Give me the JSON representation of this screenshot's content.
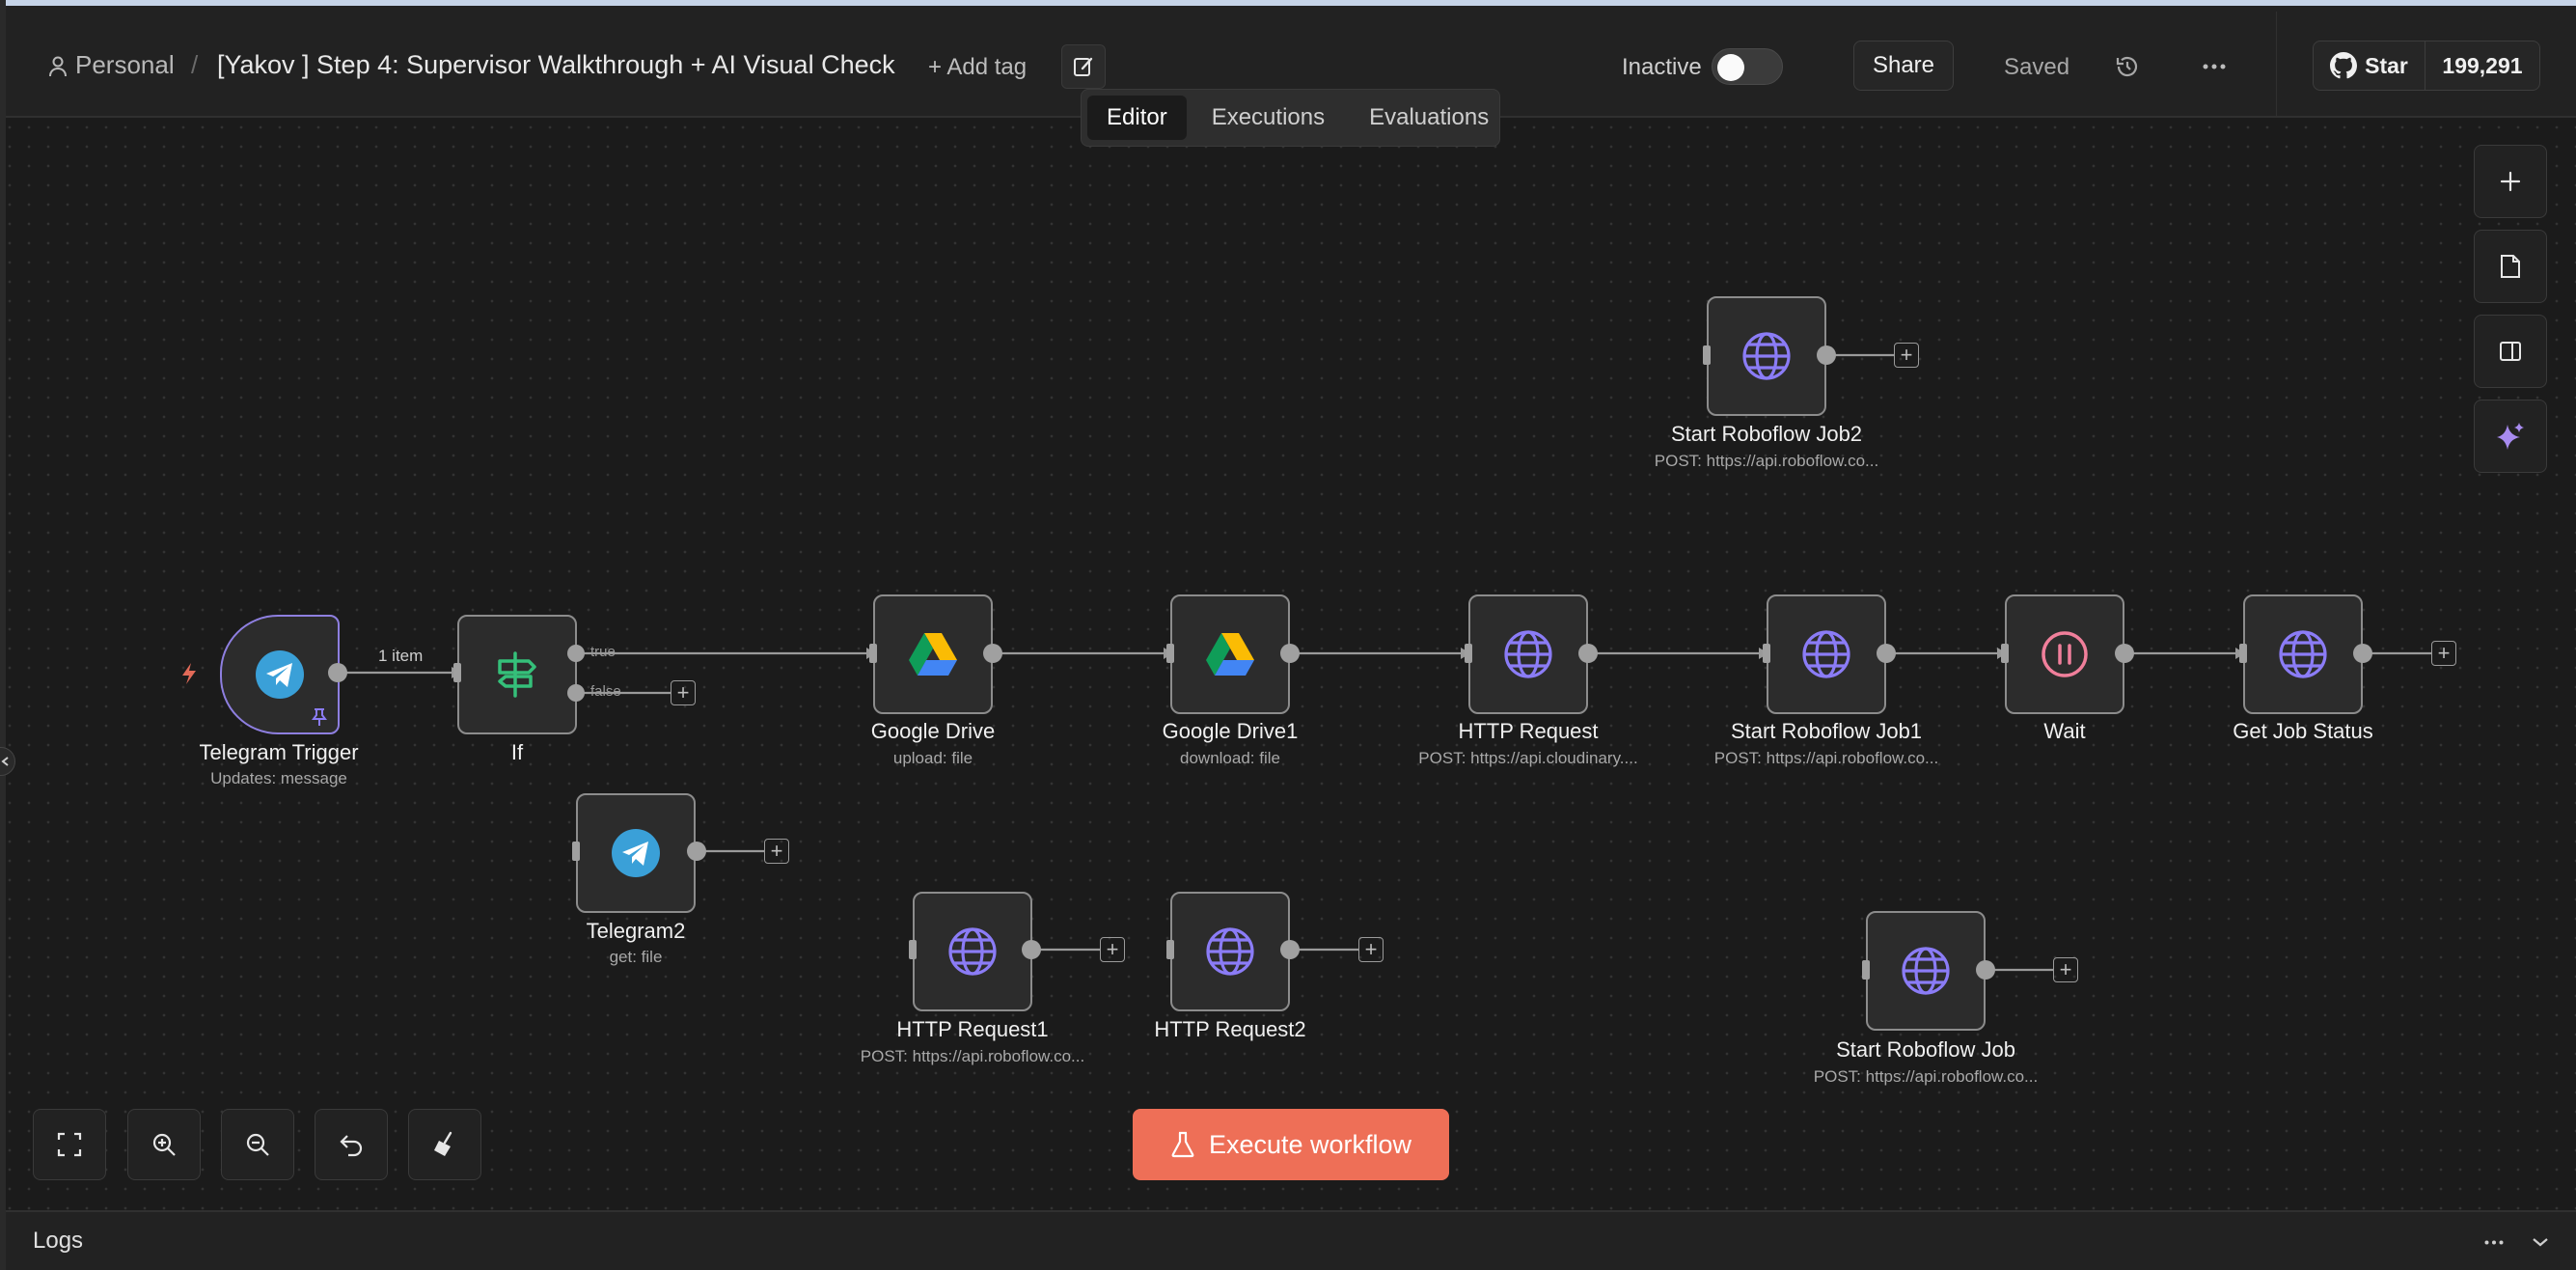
{
  "header": {
    "breadcrumb_project": "Personal",
    "separator": "/",
    "workflow_title": "[Yakov ] Step 4: Supervisor Walkthrough + AI Visual Check",
    "add_tag_label": "+ Add tag",
    "status_label": "Inactive",
    "active": false,
    "share_label": "Share",
    "saved_label": "Saved",
    "github_star_label": "Star",
    "github_star_count": "199,291"
  },
  "tabs": [
    {
      "label": "Editor",
      "active": true
    },
    {
      "label": "Executions",
      "active": false
    },
    {
      "label": "Evaluations",
      "active": false
    }
  ],
  "nodes": {
    "telegram_trigger": {
      "label": "Telegram Trigger",
      "sub": "Updates: message",
      "icon": "telegram-icon"
    },
    "if": {
      "label": "If",
      "sub": "",
      "icon": "signpost-icon"
    },
    "telegram2": {
      "label": "Telegram2",
      "sub": "get: file",
      "icon": "telegram-icon"
    },
    "google_drive": {
      "label": "Google Drive",
      "sub": "upload: file",
      "icon": "google-drive-icon"
    },
    "google_drive1": {
      "label": "Google Drive1",
      "sub": "download: file",
      "icon": "google-drive-icon"
    },
    "http_request": {
      "label": "HTTP Request",
      "sub": "POST: https://api.cloudinary....",
      "icon": "globe-icon"
    },
    "start_roboflow_job1": {
      "label": "Start Roboflow Job1",
      "sub": "POST: https://api.roboflow.co...",
      "icon": "globe-icon"
    },
    "wait": {
      "label": "Wait",
      "sub": "",
      "icon": "pause-icon"
    },
    "get_job_status": {
      "label": "Get Job Status",
      "sub": "",
      "icon": "globe-icon"
    },
    "start_roboflow_job2": {
      "label": "Start Roboflow Job2",
      "sub": "POST: https://api.roboflow.co...",
      "icon": "globe-icon"
    },
    "http_request1": {
      "label": "HTTP Request1",
      "sub": "POST: https://api.roboflow.co...",
      "icon": "globe-icon"
    },
    "http_request2": {
      "label": "HTTP Request2",
      "sub": "",
      "icon": "globe-icon"
    },
    "start_roboflow_job": {
      "label": "Start Roboflow Job",
      "sub": "POST: https://api.roboflow.co...",
      "icon": "globe-icon"
    }
  },
  "edges": {
    "trigger_to_if_label": "1 item",
    "if_true": "true",
    "if_false": "false"
  },
  "footer": {
    "execute_label": "Execute workflow",
    "logs_label": "Logs"
  },
  "colors": {
    "accent": "#ee6f57",
    "globe": "#8b7cf6",
    "trigger_border": "#8e7fe0",
    "telegram": "#3aa0d8",
    "signpost": "#35c07a",
    "wait": "#f07f9b",
    "background": "#1b1b1b"
  }
}
